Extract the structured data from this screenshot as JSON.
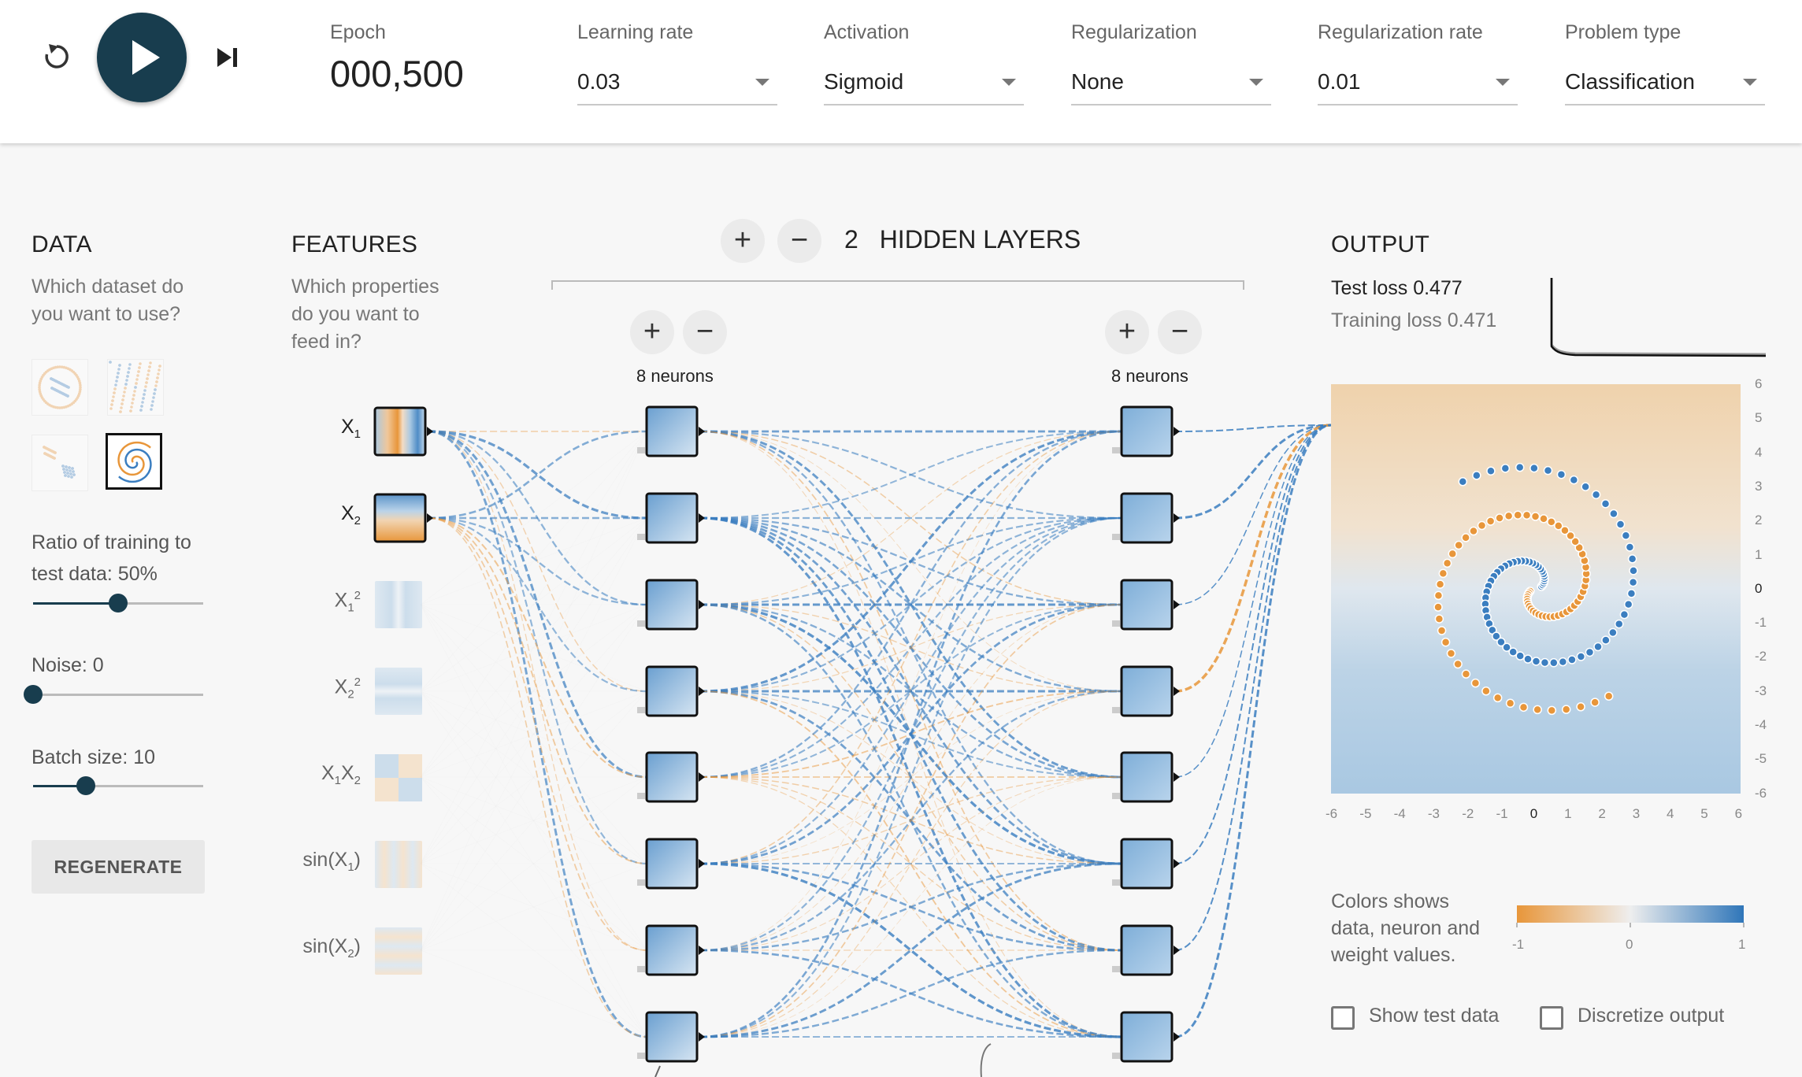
{
  "controls": {
    "reset_icon": "reset-icon",
    "play_icon": "play-icon",
    "step_icon": "step-forward-icon"
  },
  "epoch": {
    "label": "Epoch",
    "value": "000,500"
  },
  "dropdowns": [
    {
      "label": "Learning rate",
      "value": "0.03"
    },
    {
      "label": "Activation",
      "value": "Sigmoid"
    },
    {
      "label": "Regularization",
      "value": "None"
    },
    {
      "label": "Regularization rate",
      "value": "0.01"
    },
    {
      "label": "Problem type",
      "value": "Classification"
    }
  ],
  "data_section": {
    "title": "DATA",
    "subtitle_lines": [
      "Which dataset do",
      "you want to use?"
    ],
    "datasets": [
      "circle",
      "xor",
      "gaussian",
      "spiral"
    ],
    "selected_dataset": "spiral",
    "ratio_label": "Ratio of training to",
    "ratio_line2": "test data:  50%",
    "ratio_value": 50,
    "noise_label": "Noise:  0",
    "noise_value": 0,
    "batch_label": "Batch size:  10",
    "batch_value": 10,
    "regenerate": "REGENERATE"
  },
  "features_section": {
    "title": "FEATURES",
    "subtitle_lines": [
      "Which properties",
      "do you want to",
      "feed in?"
    ],
    "features": [
      {
        "base": "X",
        "sub": "1",
        "sup": "",
        "tail": "",
        "active": true
      },
      {
        "base": "X",
        "sub": "2",
        "sup": "",
        "tail": "",
        "active": true
      },
      {
        "base": "X",
        "sub": "1",
        "sup": "2",
        "tail": "",
        "active": false
      },
      {
        "base": "X",
        "sub": "2",
        "sup": "2",
        "tail": "",
        "active": false
      },
      {
        "base": "X",
        "sub": "1",
        "sup": "",
        "tail": "X2",
        "active": false
      },
      {
        "base": "sin(X",
        "sub": "1",
        "sup": "",
        "tail": ")",
        "active": false
      },
      {
        "base": "sin(X",
        "sub": "2",
        "sup": "",
        "tail": ")",
        "active": false
      }
    ]
  },
  "hidden_layers": {
    "count": "2",
    "title": "HIDDEN LAYERS",
    "layers": [
      {
        "neurons_label": "8 neurons"
      },
      {
        "neurons_label": "8 neurons"
      }
    ]
  },
  "output_section": {
    "title": "OUTPUT",
    "test_loss": "Test loss 0.477",
    "training_loss": "Training loss 0.471",
    "axis_ticks": [
      "-6",
      "-5",
      "-4",
      "-3",
      "-2",
      "-1",
      "0",
      "1",
      "2",
      "3",
      "4",
      "5",
      "6"
    ],
    "legend_lines": [
      "Colors shows",
      "data, neuron and",
      "weight values."
    ],
    "legend_ticks": [
      "-1",
      "0",
      "1"
    ],
    "show_test_data": "Show test data",
    "discretize_output": "Discretize output"
  },
  "colors": {
    "orange": "#e8963a",
    "blue": "#3b7ec0",
    "dark": "#183d4e"
  }
}
